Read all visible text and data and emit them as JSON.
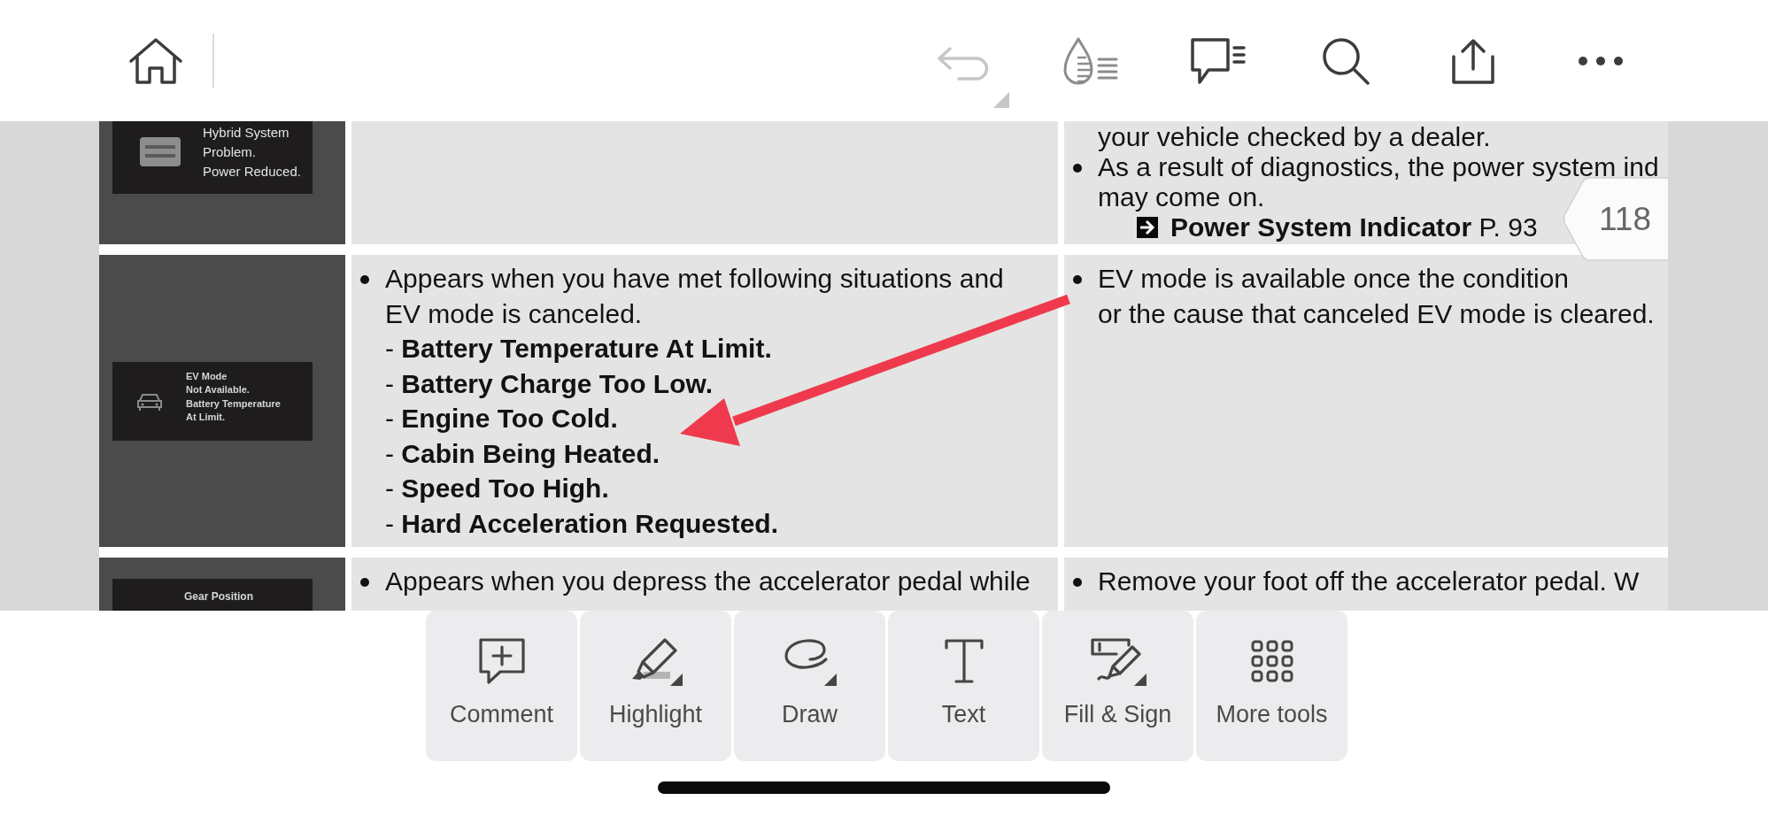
{
  "top_bar": {
    "left_buttons": [
      {
        "kind": "home",
        "disabled": false
      }
    ],
    "right_buttons": [
      {
        "kind": "undo",
        "disabled": true
      },
      {
        "kind": "droplet",
        "disabled": false
      },
      {
        "kind": "comments",
        "disabled": false
      },
      {
        "kind": "search",
        "disabled": false
      },
      {
        "kind": "share",
        "disabled": false
      },
      {
        "kind": "more",
        "disabled": false
      }
    ]
  },
  "document": {
    "rows": [
      {
        "column_1": {
          "kind": "power",
          "lines": [
            "Hybrid System",
            "Problem.",
            "Power Reduced."
          ]
        },
        "column_3": [
          {
            "kind": "text",
            "lines": [
              "your vehicle checked by a dealer."
            ]
          },
          {
            "kind": "bullet",
            "lines": [
              "As a result of diagnostics, the power system ind",
              "may come on."
            ]
          },
          {
            "kind": "reference",
            "text": "**Power System Indicator** P. 93"
          }
        ]
      },
      {
        "column_1": {
          "kind": "ev",
          "lines": [
            "EV Mode",
            "Not Available.",
            "Battery Temperature",
            "At Limit."
          ]
        },
        "column_2": [
          {
            "kind": "bullet",
            "lines": [
              "Appears when you have met following situations and",
              "EV mode is canceled."
            ]
          },
          {
            "kind": "dash",
            "text": "- **Battery Temperature At Limit.**"
          },
          {
            "kind": "dash",
            "text": "- **Battery Charge Too Low.**"
          },
          {
            "kind": "dash",
            "text": "- **Engine Too Cold.**"
          },
          {
            "kind": "dash",
            "text": "- **Cabin Being Heated.**"
          },
          {
            "kind": "dash",
            "text": "- **Speed Too High.**"
          },
          {
            "kind": "dash",
            "text": "- **Hard Acceleration Requested.**"
          }
        ],
        "column_3": [
          {
            "kind": "bullet",
            "lines": [
              "EV mode is available once the condition",
              "or the cause that canceled EV mode is cleared."
            ]
          }
        ]
      },
      {
        "column_1": {
          "kind": "gear",
          "lines": [
            "Gear Position"
          ]
        },
        "column_2": [
          {
            "kind": "bullet",
            "lines": [
              "Appears when you depress the accelerator pedal while"
            ]
          }
        ],
        "column_3": [
          {
            "kind": "bullet",
            "lines": [
              "Remove your foot off the accelerator pedal. W"
            ]
          }
        ]
      }
    ],
    "page_number": "118",
    "annotations": [
      {
        "kind": "arrow"
      }
    ]
  },
  "bottom_toolbar": {
    "tools": [
      {
        "kind": "comment",
        "label": "Comment"
      },
      {
        "kind": "highlight",
        "label": "Highlight"
      },
      {
        "kind": "draw",
        "label": "Draw"
      },
      {
        "kind": "text",
        "label": "Text"
      },
      {
        "kind": "fill_sign",
        "label": "Fill & Sign"
      },
      {
        "kind": "more_tools",
        "label": "More tools"
      }
    ]
  }
}
